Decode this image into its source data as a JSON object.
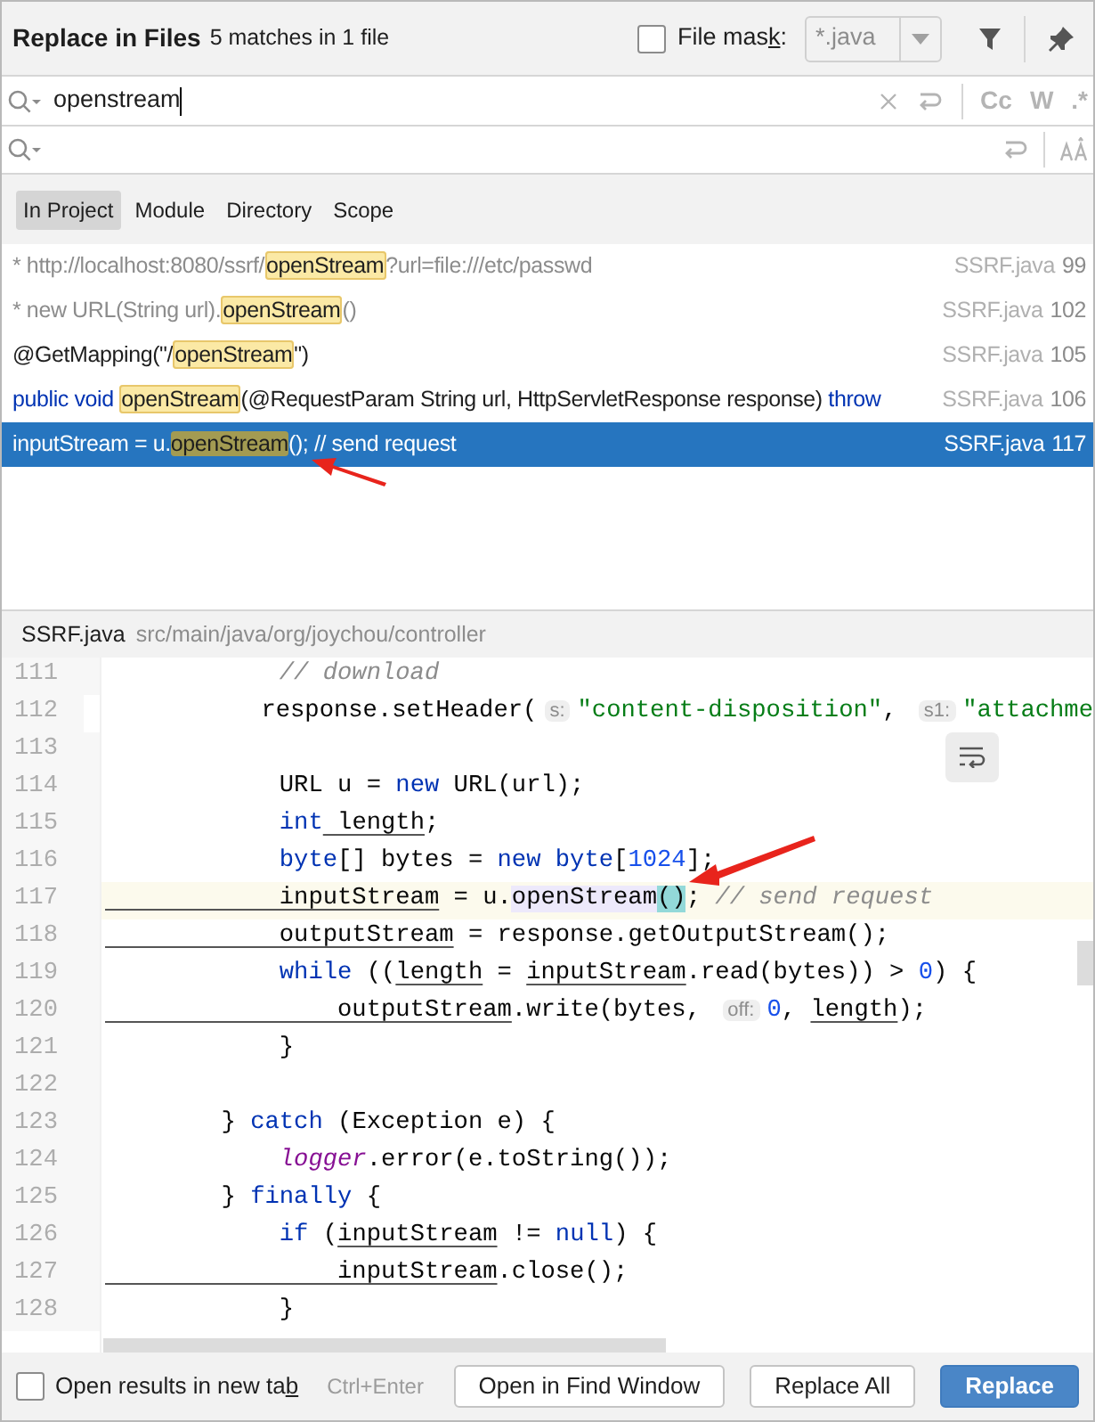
{
  "header": {
    "title": "Replace in Files",
    "subtitle": "5 matches in 1 file",
    "file_mask": {
      "label_before": "File mas",
      "label_key": "k",
      "label_after": ":",
      "checked": false,
      "value": "*.java"
    }
  },
  "search": {
    "value": "openstream",
    "options": [
      "Cc",
      "W",
      ".*"
    ]
  },
  "scopes": [
    {
      "label": "In Project",
      "selected": true
    },
    {
      "label": "Module",
      "selected": false
    },
    {
      "label": "Directory",
      "selected": false
    },
    {
      "label": "Scope",
      "selected": false
    }
  ],
  "results": [
    {
      "parts": [
        {
          "text": "* http://localhost:8080/ssrf/",
          "kind": "comment"
        },
        {
          "text": "openStream",
          "kind": "match"
        },
        {
          "text": "?url=file:///etc/passwd",
          "kind": "comment"
        }
      ],
      "file": "SSRF.java",
      "line": "99",
      "selected": false
    },
    {
      "parts": [
        {
          "text": "* new URL(String url).",
          "kind": "comment"
        },
        {
          "text": "openStream",
          "kind": "match"
        },
        {
          "text": "()",
          "kind": "comment"
        }
      ],
      "file": "SSRF.java",
      "line": "102",
      "selected": false
    },
    {
      "parts": [
        {
          "text": "@GetMapping(\"/",
          "kind": "plain"
        },
        {
          "text": "openStream",
          "kind": "match"
        },
        {
          "text": "\")",
          "kind": "plain"
        }
      ],
      "file": "SSRF.java",
      "line": "105",
      "selected": false
    },
    {
      "parts": [
        {
          "text": "public void ",
          "kind": "keyword"
        },
        {
          "text": "openStream",
          "kind": "match"
        },
        {
          "text": "(@RequestParam String url, HttpServletResponse response) ",
          "kind": "plain"
        },
        {
          "text": "throw",
          "kind": "keyword"
        }
      ],
      "file": "SSRF.java",
      "line": "106",
      "selected": false
    },
    {
      "parts": [
        {
          "text": "inputStream = u.",
          "kind": "plain"
        },
        {
          "text": "openStream",
          "kind": "match"
        },
        {
          "text": "(); // send request",
          "kind": "plain"
        }
      ],
      "file": "SSRF.java",
      "line": "117",
      "selected": true
    }
  ],
  "preview": {
    "file": "SSRF.java",
    "path": "src/main/java/org/joychou/controller",
    "lines": [
      {
        "n": "111",
        "current": false,
        "tokens": [
          {
            "text": "            // download",
            "kind": "com"
          }
        ]
      },
      {
        "n": "112",
        "current": false,
        "tokens": [
          {
            "text": "            response.setHeader(",
            "kind": "p"
          },
          {
            "text": "s:",
            "kind": "hint"
          },
          {
            "text": "\"content-disposition\"",
            "kind": "str"
          },
          {
            "text": ", ",
            "kind": "p"
          },
          {
            "text": "s1:",
            "kind": "hint"
          },
          {
            "text": "\"attachme",
            "kind": "str"
          }
        ]
      },
      {
        "n": "113",
        "current": false
      },
      {
        "n": "114",
        "current": false,
        "tokens": [
          {
            "text": "            URL u = ",
            "kind": "p"
          },
          {
            "text": "new",
            "kind": "kw"
          },
          {
            "text": " URL(url);",
            "kind": "p"
          }
        ]
      },
      {
        "n": "115",
        "current": false,
        "tokens": [
          {
            "text": "            int",
            "kind": "kw"
          },
          {
            "text": " length",
            "kind": "var"
          },
          {
            "text": ";",
            "kind": "p"
          }
        ]
      },
      {
        "n": "116",
        "current": false,
        "tokens": [
          {
            "text": "            byte",
            "kind": "kw"
          },
          {
            "text": "[] bytes = ",
            "kind": "p"
          },
          {
            "text": "new byte",
            "kind": "kw"
          },
          {
            "text": "[",
            "kind": "p"
          },
          {
            "text": "1024",
            "kind": "num"
          },
          {
            "text": "];",
            "kind": "p"
          }
        ]
      },
      {
        "n": "117",
        "current": true,
        "tokens": [
          {
            "text": "            inputStream",
            "kind": "var"
          },
          {
            "text": " = u.",
            "kind": "p"
          },
          {
            "text": "openStream",
            "kind": "ref"
          },
          {
            "text": "()",
            "kind": "brace"
          },
          {
            "text": "; ",
            "kind": "p"
          },
          {
            "text": "// send request",
            "kind": "com"
          }
        ]
      },
      {
        "n": "118",
        "current": false,
        "tokens": [
          {
            "text": "            outputStream",
            "kind": "var"
          },
          {
            "text": " = response.getOutputStream();",
            "kind": "p"
          }
        ]
      },
      {
        "n": "119",
        "current": false,
        "tokens": [
          {
            "text": "            while",
            "kind": "kw"
          },
          {
            "text": " ((",
            "kind": "p"
          },
          {
            "text": "length",
            "kind": "var"
          },
          {
            "text": " = ",
            "kind": "p"
          },
          {
            "text": "inputStream",
            "kind": "var"
          },
          {
            "text": ".read(bytes)) > ",
            "kind": "p"
          },
          {
            "text": "0",
            "kind": "num"
          },
          {
            "text": ") {",
            "kind": "p"
          }
        ]
      },
      {
        "n": "120",
        "current": false,
        "tokens": [
          {
            "text": "                outputStream",
            "kind": "var"
          },
          {
            "text": ".write(bytes, ",
            "kind": "p"
          },
          {
            "text": "off:",
            "kind": "hint"
          },
          {
            "text": "0",
            "kind": "num"
          },
          {
            "text": ", ",
            "kind": "p"
          },
          {
            "text": "length",
            "kind": "var"
          },
          {
            "text": ");",
            "kind": "p"
          }
        ]
      },
      {
        "n": "121",
        "current": false,
        "tokens": [
          {
            "text": "            }",
            "kind": "p"
          }
        ]
      },
      {
        "n": "122",
        "current": false
      },
      {
        "n": "123",
        "current": false,
        "tokens": [
          {
            "text": "        } ",
            "kind": "p"
          },
          {
            "text": "catch",
            "kind": "kw"
          },
          {
            "text": " (Exception e) {",
            "kind": "p"
          }
        ]
      },
      {
        "n": "124",
        "current": false,
        "tokens": [
          {
            "text": "            logger",
            "kind": "fld"
          },
          {
            "text": ".error(e.toString());",
            "kind": "p"
          }
        ]
      },
      {
        "n": "125",
        "current": false,
        "tokens": [
          {
            "text": "        } ",
            "kind": "p"
          },
          {
            "text": "finally",
            "kind": "kw"
          },
          {
            "text": " {",
            "kind": "p"
          }
        ]
      },
      {
        "n": "126",
        "current": false,
        "tokens": [
          {
            "text": "            if",
            "kind": "kw"
          },
          {
            "text": " (",
            "kind": "p"
          },
          {
            "text": "inputStream",
            "kind": "var"
          },
          {
            "text": " != ",
            "kind": "p"
          },
          {
            "text": "null",
            "kind": "kw"
          },
          {
            "text": ") {",
            "kind": "p"
          }
        ]
      },
      {
        "n": "127",
        "current": false,
        "tokens": [
          {
            "text": "                inputStream",
            "kind": "var"
          },
          {
            "text": ".close();",
            "kind": "p"
          }
        ]
      },
      {
        "n": "128",
        "current": false,
        "tokens": [
          {
            "text": "            }",
            "kind": "p"
          }
        ]
      }
    ]
  },
  "footer": {
    "new_tab": {
      "label_before": "Open results in new ta",
      "label_key": "b",
      "checked": false
    },
    "shortcut": "Ctrl+Enter",
    "buttons": [
      {
        "label": "Open in Find Window",
        "kind": "plain"
      },
      {
        "label": "Replace All",
        "kind": "plain"
      },
      {
        "label": "Replace",
        "kind": "primary"
      }
    ]
  }
}
